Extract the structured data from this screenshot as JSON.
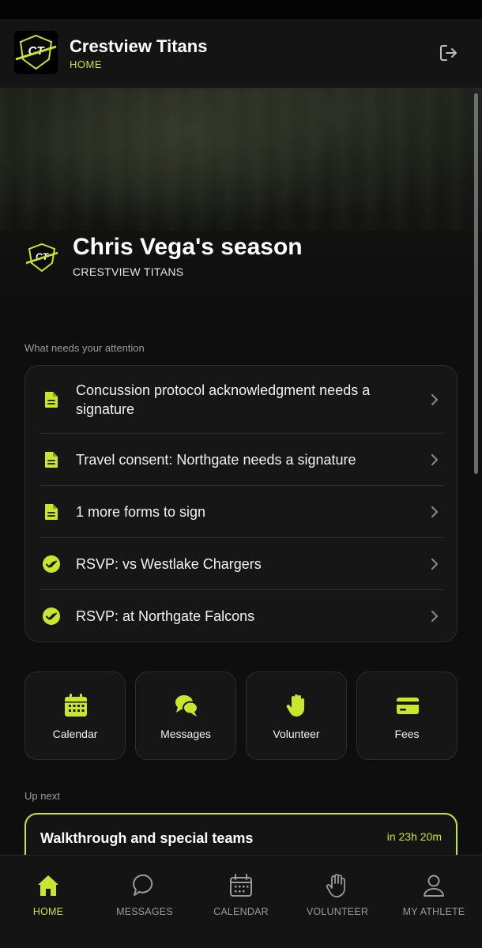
{
  "header": {
    "team_name": "Crestview Titans",
    "section": "HOME",
    "logo_text": "CT"
  },
  "hero": {
    "badge_text": "CT",
    "title": "Chris Vega's season",
    "subtitle": "CRESTVIEW TITANS"
  },
  "attention": {
    "label": "What needs your attention",
    "items": [
      {
        "icon": "document-icon",
        "text": "Concussion protocol acknowledgment needs a signature"
      },
      {
        "icon": "document-icon",
        "text": "Travel consent: Northgate needs a signature"
      },
      {
        "icon": "document-icon",
        "text": "1 more forms to sign"
      },
      {
        "icon": "check-circle-icon",
        "text": "RSVP: vs Westlake Chargers"
      },
      {
        "icon": "check-circle-icon",
        "text": "RSVP: at Northgate Falcons"
      }
    ]
  },
  "quick_actions": [
    {
      "icon": "calendar-icon",
      "label": "Calendar"
    },
    {
      "icon": "chat-bubbles-icon",
      "label": "Messages"
    },
    {
      "icon": "hand-icon",
      "label": "Volunteer"
    },
    {
      "icon": "card-icon",
      "label": "Fees"
    }
  ],
  "up_next": {
    "label": "Up next",
    "title": "Walkthrough and special teams",
    "countdown": "in 23h 20m"
  },
  "tabs": [
    {
      "icon": "home-icon",
      "label": "HOME",
      "active": true
    },
    {
      "icon": "chat-icon",
      "label": "MESSAGES",
      "active": false
    },
    {
      "icon": "calendar-icon",
      "label": "CALENDAR",
      "active": false
    },
    {
      "icon": "hand-icon",
      "label": "VOLUNTEER",
      "active": false
    },
    {
      "icon": "person-icon",
      "label": "MY ATHLETE",
      "active": false
    }
  ],
  "colors": {
    "accent": "#c8e62c",
    "background": "#0e0e0e",
    "card": "#161616",
    "muted_text": "#9a9a9a"
  }
}
